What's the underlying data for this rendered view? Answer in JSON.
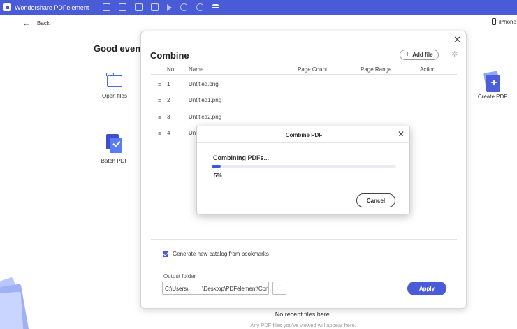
{
  "app": {
    "title": "Wondershare PDFelement",
    "toolbar_icons": [
      "folder-icon",
      "save-icon",
      "mail-icon",
      "print-icon",
      "play-icon",
      "undo-icon",
      "redo-icon",
      "menu-icon"
    ]
  },
  "background": {
    "back_label": "Back",
    "device_label": "iPhone",
    "greeting": "Good evenin",
    "open_files_label": "Open files",
    "batch_pdf_label": "Batch PDF",
    "create_pdf_label": "Create PDF",
    "recent_title": "No recent files here.",
    "recent_subtitle": "Any PDF files you've viewed will appear here."
  },
  "combine": {
    "title": "Combine",
    "add_file_label": "Add file",
    "columns": [
      "No.",
      "Page Count",
      "Page Range",
      "Action"
    ],
    "name_column": "Name",
    "rows": [
      {
        "no": "1",
        "name": "Untitled.png"
      },
      {
        "no": "2",
        "name": "Untitled1.png"
      },
      {
        "no": "3",
        "name": "Untitled2.png"
      },
      {
        "no": "4",
        "name": "Unti"
      }
    ],
    "generate_catalog_label": "Generate new catalog from bookmarks",
    "generate_catalog_checked": true,
    "output_folder_label": "Output folder",
    "output_folder_value": "C:\\Users\\         \\Desktop\\PDFelement\\Com",
    "browse_label": "···",
    "apply_label": "Apply"
  },
  "progress_dialog": {
    "title": "Combine PDF",
    "status": "Combining PDFs...",
    "percent_text": "5%",
    "progress": 0.05,
    "cancel_label": "Cancel"
  },
  "colors": {
    "titlebar": "#4a5bd8",
    "accent": "#4a5bd8",
    "progress_fill": "#3d5bd6"
  }
}
